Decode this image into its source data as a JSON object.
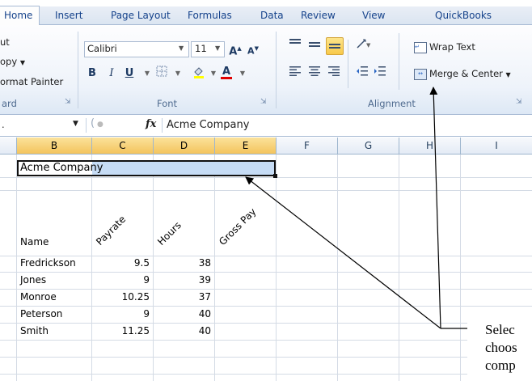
{
  "tabs": [
    "Home",
    "Insert",
    "Page Layout",
    "Formulas",
    "Data",
    "Review",
    "View",
    "QuickBooks"
  ],
  "clipboard": {
    "cut": "ut",
    "copy": "opy",
    "format_painter": "ormat Painter",
    "group_label": "ard"
  },
  "font": {
    "name": "Calibri",
    "size": "11",
    "group_label": "Font"
  },
  "alignment": {
    "wrap_text": "Wrap Text",
    "merge_center": "Merge & Center",
    "group_label": "Alignment"
  },
  "formula_bar": {
    "fx": "fx",
    "value": "Acme Company"
  },
  "columns": [
    "B",
    "C",
    "D",
    "E",
    "F",
    "G",
    "H",
    "I"
  ],
  "sheet": {
    "title": "Acme Company",
    "headers": {
      "name": "Name",
      "payrate": "Payrate",
      "hours": "Hours",
      "gross": "Gross Pay"
    },
    "rows": [
      {
        "name": "Fredrickson",
        "payrate": "9.5",
        "hours": "38"
      },
      {
        "name": "Jones",
        "payrate": "9",
        "hours": "39"
      },
      {
        "name": "Monroe",
        "payrate": "10.25",
        "hours": "37"
      },
      {
        "name": "Peterson",
        "payrate": "9",
        "hours": "40"
      },
      {
        "name": "Smith",
        "payrate": "11.25",
        "hours": "40"
      }
    ]
  },
  "caption": {
    "line1": "Selec",
    "line2": "choos",
    "line3": "comp"
  },
  "colors": {
    "selection": "#c6dcf5",
    "accent": "#15428b",
    "header_selected": "#f6cf6c"
  }
}
